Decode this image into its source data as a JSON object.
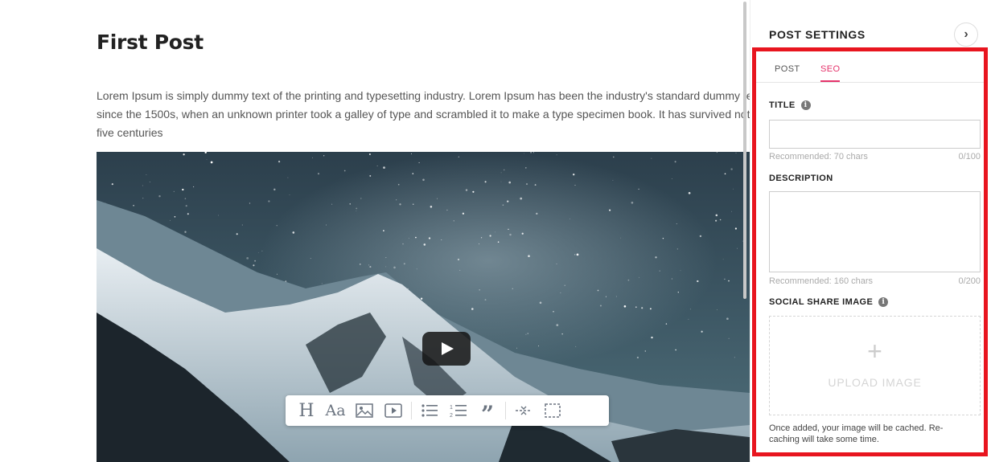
{
  "editor": {
    "title": "First Post",
    "body": "Lorem Ipsum is simply dummy text of the printing and typesetting industry. Lorem Ipsum has been the industry's standard dummy text ever since the 1500s, when an unknown printer took a galley of type and scrambled it to make a type specimen book. It has survived not only five centuries",
    "media_type": "video",
    "toolbar": {
      "heading_label": "H",
      "font_label": "Aa",
      "quote_label": "”",
      "icons": [
        "heading-icon",
        "font-size-icon",
        "image-icon",
        "video-icon",
        "bulleted-list-icon",
        "numbered-list-icon",
        "quote-icon",
        "divider-icon",
        "embed-icon"
      ]
    }
  },
  "settings": {
    "panel_title": "POST SETTINGS",
    "collapse_glyph": "›",
    "tabs": [
      {
        "label": "POST",
        "active": false
      },
      {
        "label": "SEO",
        "active": true
      }
    ],
    "seo": {
      "title_label": "TITLE",
      "title_value": "",
      "title_hint": "Recommended: 70 chars",
      "title_counter": "0/100",
      "description_label": "DESCRIPTION",
      "description_value": "",
      "description_hint": "Recommended: 160 chars",
      "description_counter": "0/200",
      "share_image_label": "SOCIAL SHARE IMAGE",
      "upload_plus": "+",
      "upload_label": "UPLOAD IMAGE",
      "cache_note": "Once added, your image will be cached. Re-caching will take some time."
    }
  },
  "colors": {
    "accent": "#e5336b",
    "highlight_border": "#e8151f"
  }
}
